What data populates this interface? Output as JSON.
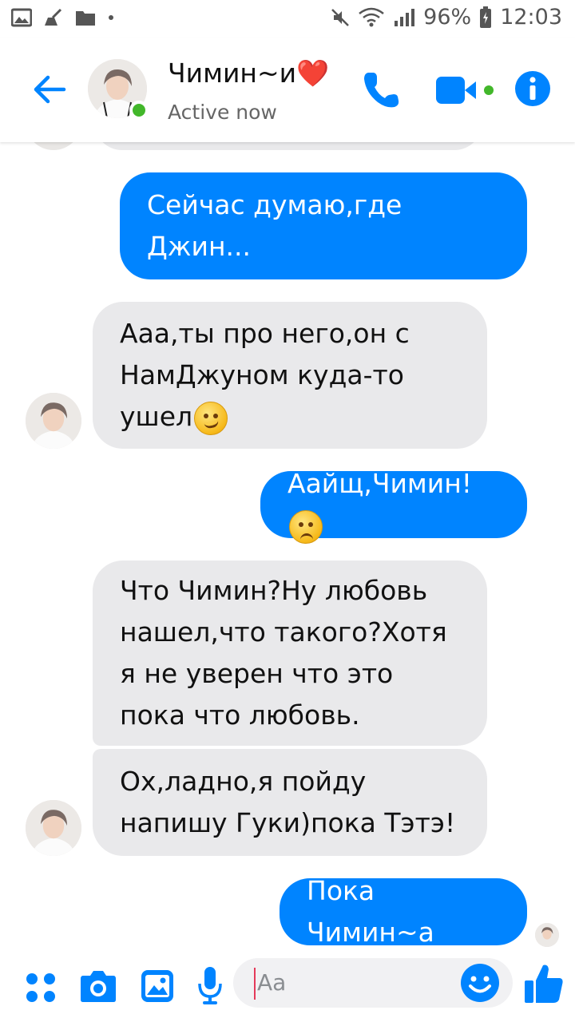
{
  "status_bar": {
    "battery": "96%",
    "time": "12:03"
  },
  "header": {
    "contact_name": "Чимин~и❤️",
    "status": "Active now"
  },
  "messages": [
    {
      "direction": "out",
      "text": "Сейчас думаю,где Джин..."
    },
    {
      "direction": "in",
      "text": "Ааа,ты про него,он с НамДжуном куда-то ушел",
      "emoji": "smirk"
    },
    {
      "direction": "out",
      "text": "Аайщ,Чимин!",
      "emoji": "sad"
    },
    {
      "direction": "in",
      "text": "Что Чимин?Ну любовь нашел,что такого?Хотя я не уверен что это пока что любовь."
    },
    {
      "direction": "in",
      "text": "Ох,ладно,я пойду напишу Гуки)пока Тэтэ!"
    },
    {
      "direction": "out",
      "text": "Пока Чимин~а"
    }
  ],
  "composer": {
    "placeholder": "Aa"
  },
  "colors": {
    "accent": "#0084ff",
    "incoming_bubble": "#e9e9eb",
    "online": "#42b72a"
  }
}
